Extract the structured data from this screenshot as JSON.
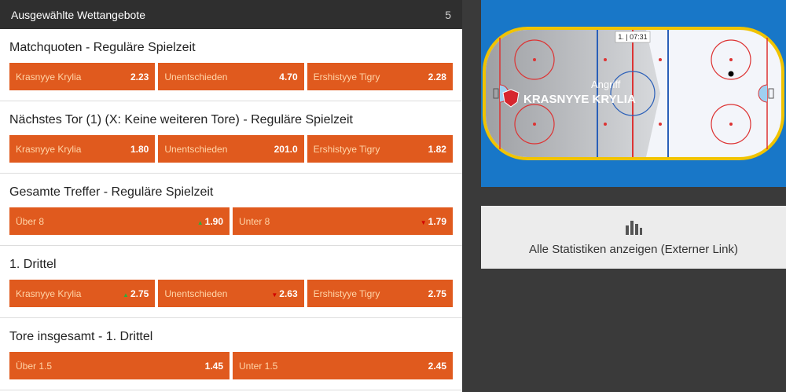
{
  "header": {
    "title": "Ausgewählte Wettangebote",
    "count": "5"
  },
  "markets": [
    {
      "title": "Matchquoten - Reguläre Spielzeit",
      "odds": [
        {
          "label": "Krasnyye Krylia",
          "value": "2.23",
          "trend": ""
        },
        {
          "label": "Unentschieden",
          "value": "4.70",
          "trend": ""
        },
        {
          "label": "Ershistyye Tigry",
          "value": "2.28",
          "trend": ""
        }
      ]
    },
    {
      "title": "Nächstes Tor (1) (X: Keine weiteren Tore) - Reguläre Spielzeit",
      "odds": [
        {
          "label": "Krasnyye Krylia",
          "value": "1.80",
          "trend": ""
        },
        {
          "label": "Unentschieden",
          "value": "201.0",
          "trend": ""
        },
        {
          "label": "Ershistyye Tigry",
          "value": "1.82",
          "trend": ""
        }
      ]
    },
    {
      "title": "Gesamte Treffer - Reguläre Spielzeit",
      "odds": [
        {
          "label": "Über 8",
          "value": "1.90",
          "trend": "up"
        },
        {
          "label": "Unter 8",
          "value": "1.79",
          "trend": "down"
        }
      ]
    },
    {
      "title": "1. Drittel",
      "odds": [
        {
          "label": "Krasnyye Krylia",
          "value": "2.75",
          "trend": "up"
        },
        {
          "label": "Unentschieden",
          "value": "2.63",
          "trend": "down"
        },
        {
          "label": "Ershistyye Tigry",
          "value": "2.75",
          "trend": ""
        }
      ]
    },
    {
      "title": "Tore insgesamt - 1. Drittel",
      "odds": [
        {
          "label": "Über 1.5",
          "value": "1.45",
          "trend": ""
        },
        {
          "label": "Unter 1.5",
          "value": "2.45",
          "trend": ""
        }
      ]
    }
  ],
  "rink": {
    "period_time": "1. | 07:31",
    "attack_label": "Angriff",
    "attacking_team": "KRASNYYE KRYLIA",
    "icon": "team-shield-icon"
  },
  "stats": {
    "link_text": "Alle Statistiken anzeigen (Externer Link)",
    "icon": "bar-chart-icon"
  },
  "colors": {
    "odd_bg": "#e05a1e",
    "odd_label": "#ffd5a8",
    "header_bg": "#2f2f2f",
    "rink_bg": "#1877c8"
  }
}
